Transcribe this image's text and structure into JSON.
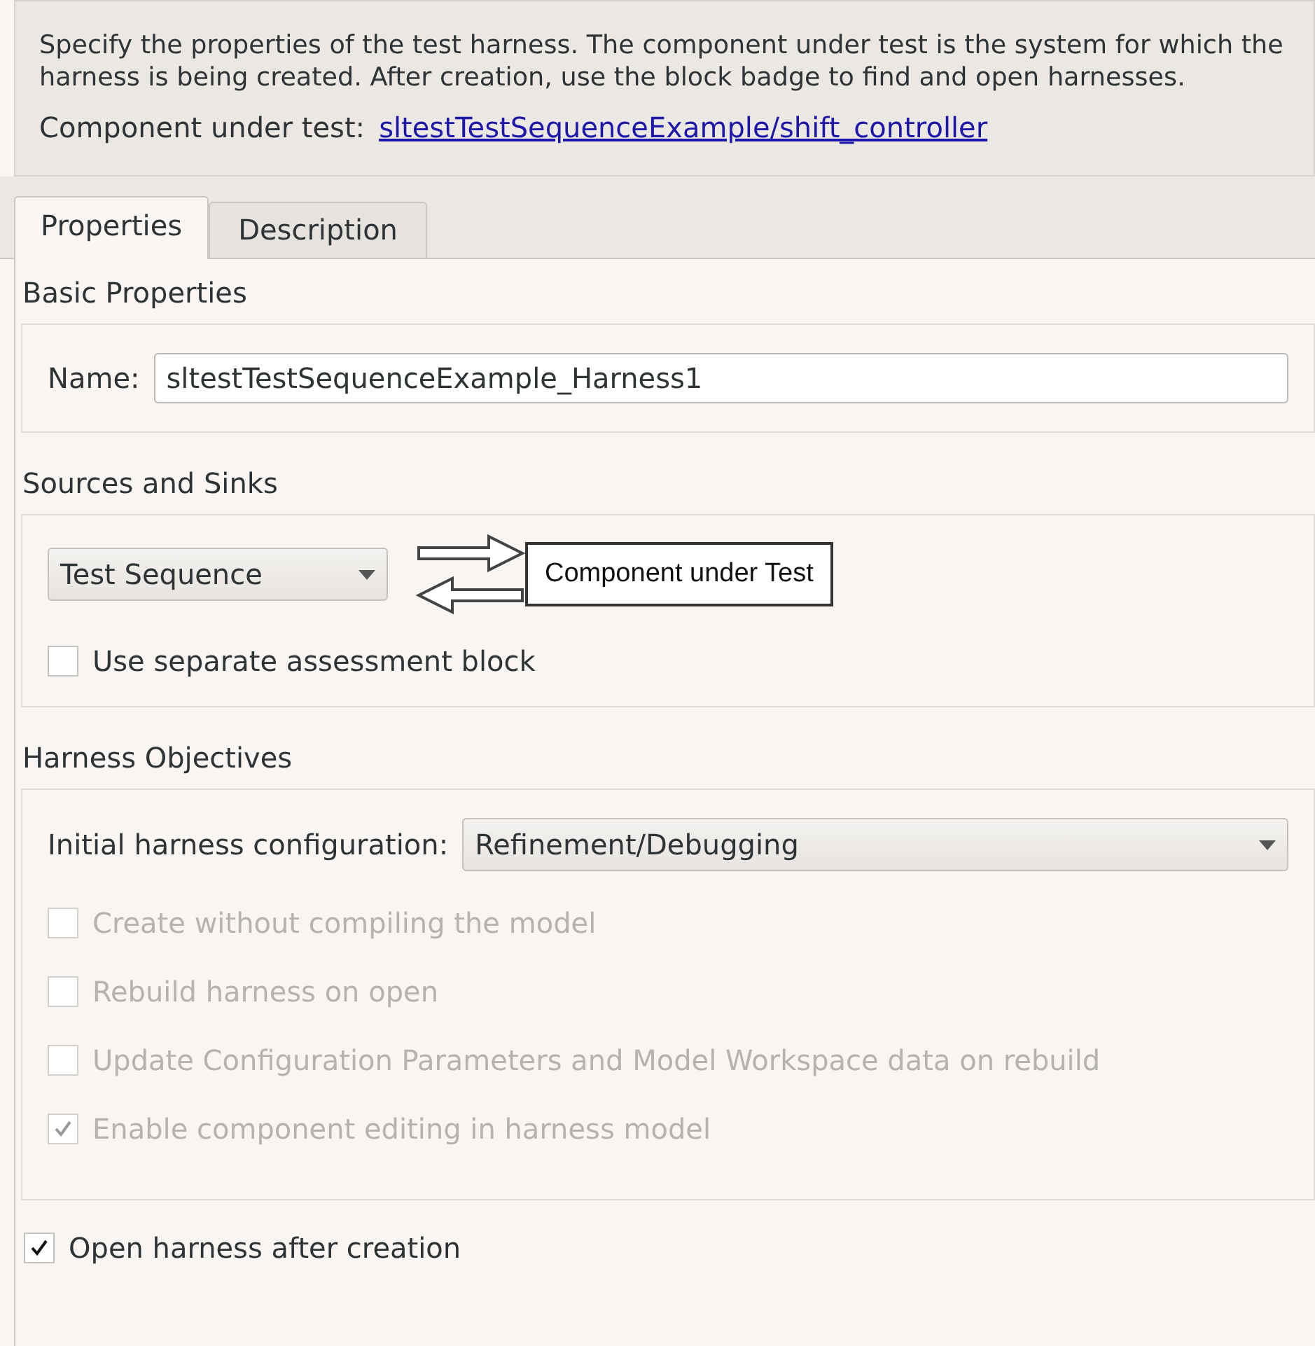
{
  "header": {
    "description": "Specify the properties of the test harness. The component under test is the system for which the harness is being created. After creation, use the block badge to find and open harnesses.",
    "component_label": "Component under test:",
    "component_link": "sltestTestSequenceExample/shift_controller"
  },
  "tabs": [
    {
      "label": "Properties",
      "selected": true
    },
    {
      "label": "Description",
      "selected": false
    }
  ],
  "basic_properties": {
    "title": "Basic Properties",
    "name_label": "Name:",
    "name_value": "sltestTestSequenceExample_Harness1"
  },
  "sources_and_sinks": {
    "title": "Sources and Sinks",
    "source": "Test Sequence",
    "component_block": "Component under Test",
    "separate_assessment": {
      "label": "Use separate assessment block",
      "checked": false
    }
  },
  "harness_objectives": {
    "title": "Harness Objectives",
    "config_label": "Initial harness configuration:",
    "config_value": "Refinement/Debugging",
    "options": [
      {
        "label": "Create without compiling the model",
        "checked": false,
        "disabled": true
      },
      {
        "label": "Rebuild harness on open",
        "checked": false,
        "disabled": true
      },
      {
        "label": "Update Configuration Parameters and Model Workspace data on rebuild",
        "checked": false,
        "disabled": true
      },
      {
        "label": "Enable component editing in harness model",
        "checked": true,
        "disabled": true
      }
    ]
  },
  "open_after_creation": {
    "label": "Open harness after creation",
    "checked": true
  }
}
